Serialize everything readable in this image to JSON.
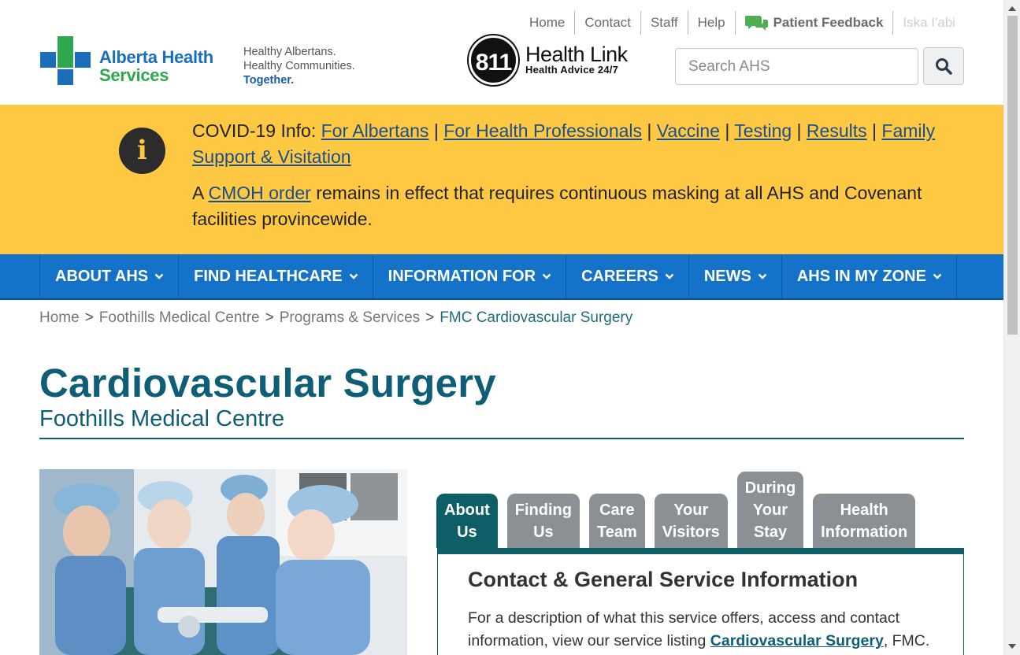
{
  "header": {
    "logo": {
      "line1": "Alberta Health",
      "line2": "Services"
    },
    "tagline": [
      "Healthy Albertans.",
      "Healthy Communities.",
      "Together."
    ],
    "healthlink": {
      "badge": "811",
      "title": "Health Link",
      "subtitle": "Health Advice 24/7"
    },
    "utility": [
      "Home",
      "Contact",
      "Staff",
      "Help"
    ],
    "feedback": "Patient Feedback",
    "language": "Iska I'abi",
    "search_placeholder": "Search AHS"
  },
  "alert": {
    "covid_prefix": "COVID-19 Info:",
    "links": [
      "For Albertans",
      "For Health Professionals",
      "Vaccine",
      "Testing",
      "Results",
      "Family Support & Visitation"
    ],
    "separator": "|",
    "masking_prefix": "A",
    "masking_link": "CMOH order",
    "masking_text": "remains in effect that requires continuous masking at all AHS and Covenant facilities provincewide."
  },
  "nav": [
    "ABOUT AHS",
    "FIND HEALTHCARE",
    "INFORMATION FOR",
    "CAREERS",
    "NEWS",
    "AHS IN MY ZONE"
  ],
  "breadcrumb": {
    "items": [
      "Home",
      "Foothills Medical Centre",
      "Programs & Services"
    ],
    "current": "FMC Cardiovascular Surgery",
    "separator": ">"
  },
  "page": {
    "title": "Cardiovascular Surgery",
    "subtitle": "Foothills Medical Centre"
  },
  "tabs": [
    {
      "l1": "About",
      "l2": "Us"
    },
    {
      "l1": "Finding",
      "l2": "Us"
    },
    {
      "l1": "Care",
      "l2": "Team"
    },
    {
      "l1": "Your",
      "l2": "Visitors"
    },
    {
      "l0": "During",
      "l1": "Your",
      "l2": "Stay"
    },
    {
      "l1": "Health",
      "l2": "Information"
    }
  ],
  "tab_content": {
    "heading": "Contact & General Service Information",
    "text_before": "For a description of what this service offers, access and contact information, view our service listing",
    "link": "Cardiovascular Surgery",
    "text_after": ", FMC."
  },
  "colors": {
    "brand_blue": "#1a6fb8",
    "brand_green": "#2ea84f",
    "alert_yellow": "#fec843",
    "nav_blue": "#1472c8",
    "title_teal": "#0d5e76",
    "tab_active": "#0e5e68",
    "tab_inactive": "#8b9095"
  },
  "icons": {
    "logo": "ahs-cross-logo",
    "feedback": "chat-bubbles-icon",
    "search": "magnifier-icon",
    "alert": "info-icon",
    "nav": "chevron-down-icon"
  }
}
